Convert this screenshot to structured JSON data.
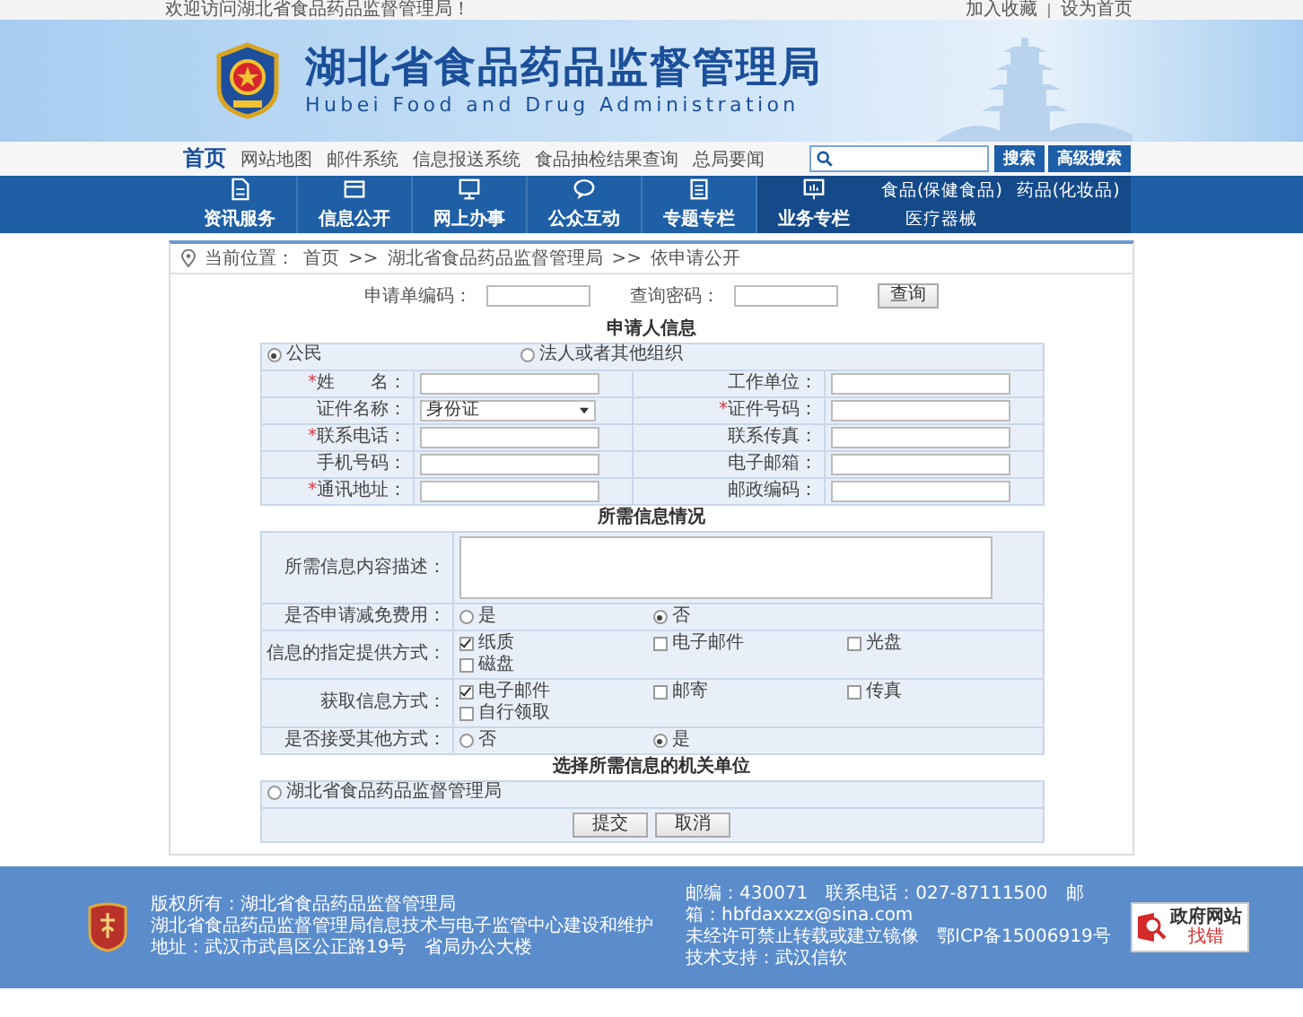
{
  "top_bar": {
    "welcome": "欢迎访问湖北省食品药品监督管理局！",
    "links": [
      "加入收藏",
      "设为首页"
    ]
  },
  "header": {
    "title_cn": "湖北省食品药品监督管理局",
    "title_en": "Hubei Food and Drug Administration"
  },
  "quick_nav": {
    "items": [
      {
        "label": "首页",
        "selected": true
      },
      {
        "label": "网站地图",
        "selected": false
      },
      {
        "label": "邮件系统",
        "selected": false
      },
      {
        "label": "信息报送系统",
        "selected": false
      },
      {
        "label": "食品抽检结果查询",
        "selected": false
      },
      {
        "label": "总局要闻",
        "selected": false
      }
    ],
    "search_buttons": [
      "搜索",
      "高级搜索"
    ]
  },
  "main_nav": {
    "items": [
      {
        "label": "资讯服务",
        "selected": false
      },
      {
        "label": "信息公开",
        "selected": false
      },
      {
        "label": "网上办事",
        "selected": false
      },
      {
        "label": "公众互动",
        "selected": false
      },
      {
        "label": "专题专栏",
        "selected": false
      },
      {
        "label": "业务专栏",
        "selected": true
      }
    ],
    "submenu": [
      "食品(保健食品)",
      "药品(化妆品)",
      "医疗器械"
    ]
  },
  "breadcrumb": {
    "label": "当前位置：",
    "links": [
      "首页",
      "湖北省食品药品监督管理局",
      "依申请公开"
    ],
    "separators": [
      ">>",
      ">>"
    ]
  },
  "query": {
    "fields": [
      {
        "label": "申请单编码："
      },
      {
        "label": "查询密码："
      }
    ],
    "button": "查询"
  },
  "applicant": {
    "title": "申请人信息",
    "types": [
      {
        "label": "公民",
        "selected": true
      },
      {
        "label": "法人或者其他组织",
        "selected": false
      }
    ],
    "fields": [
      {
        "mark": "*",
        "label": "姓　　名：",
        "kind": "input"
      },
      {
        "label": "工作单位：",
        "kind": "input"
      },
      {
        "label": "证件名称：",
        "kind": "select",
        "value": "身份证"
      },
      {
        "mark": "*",
        "label": "证件号码：",
        "kind": "input"
      },
      {
        "mark": "*",
        "label": "联系电话：",
        "kind": "input"
      },
      {
        "label": "联系传真：",
        "kind": "input"
      },
      {
        "label": "手机号码：",
        "kind": "input"
      },
      {
        "label": "电子邮箱：",
        "kind": "input"
      },
      {
        "mark": "*",
        "label": "通讯地址：",
        "kind": "input"
      },
      {
        "label": "邮政编码：",
        "kind": "input"
      }
    ]
  },
  "info": {
    "title": "所需信息情况",
    "rows": [
      {
        "kind": "textarea",
        "label": "所需信息内容描述："
      },
      {
        "kind": "radio",
        "label": "是否申请减免费用：",
        "options": [
          {
            "label": "是",
            "selected": false
          },
          {
            "label": "否",
            "selected": true
          }
        ]
      },
      {
        "kind": "checkbox",
        "label": "信息的指定提供方式：",
        "options": [
          {
            "label": "纸质",
            "checked": true
          },
          {
            "label": "电子邮件",
            "checked": false
          },
          {
            "label": "光盘",
            "checked": false
          },
          {
            "label": "磁盘",
            "checked": false
          }
        ]
      },
      {
        "kind": "checkbox",
        "label": "获取信息方式：",
        "options": [
          {
            "label": "电子邮件",
            "checked": true
          },
          {
            "label": "邮寄",
            "checked": false
          },
          {
            "label": "传真",
            "checked": false
          },
          {
            "label": "自行领取",
            "checked": false
          }
        ]
      },
      {
        "kind": "radio",
        "label": "是否接受其他方式：",
        "options": [
          {
            "label": "否",
            "selected": false
          },
          {
            "label": "是",
            "selected": true
          }
        ]
      }
    ]
  },
  "organization": {
    "title": "选择所需信息的机关单位",
    "options": [
      {
        "label": "湖北省食品药品监督管理局",
        "selected": false
      }
    ]
  },
  "buttons": [
    "提交",
    "取消"
  ],
  "footer": {
    "left": [
      "版权所有：湖北省食品药品监督管理局",
      "湖北省食品药品监督管理局信息技术与电子监管中心建设和维护",
      "地址：武汉市武昌区公正路19号　省局办公大楼"
    ],
    "right": [
      "邮编：430071　联系电话：027-87111500　邮箱：hbfdaxxzx@sina.com",
      "未经许可禁止转载或建立镜像　鄂ICP备15006919号",
      "技术支持：武汉信软"
    ],
    "badge": {
      "title": "政府网站",
      "subtitle": "找错"
    }
  }
}
